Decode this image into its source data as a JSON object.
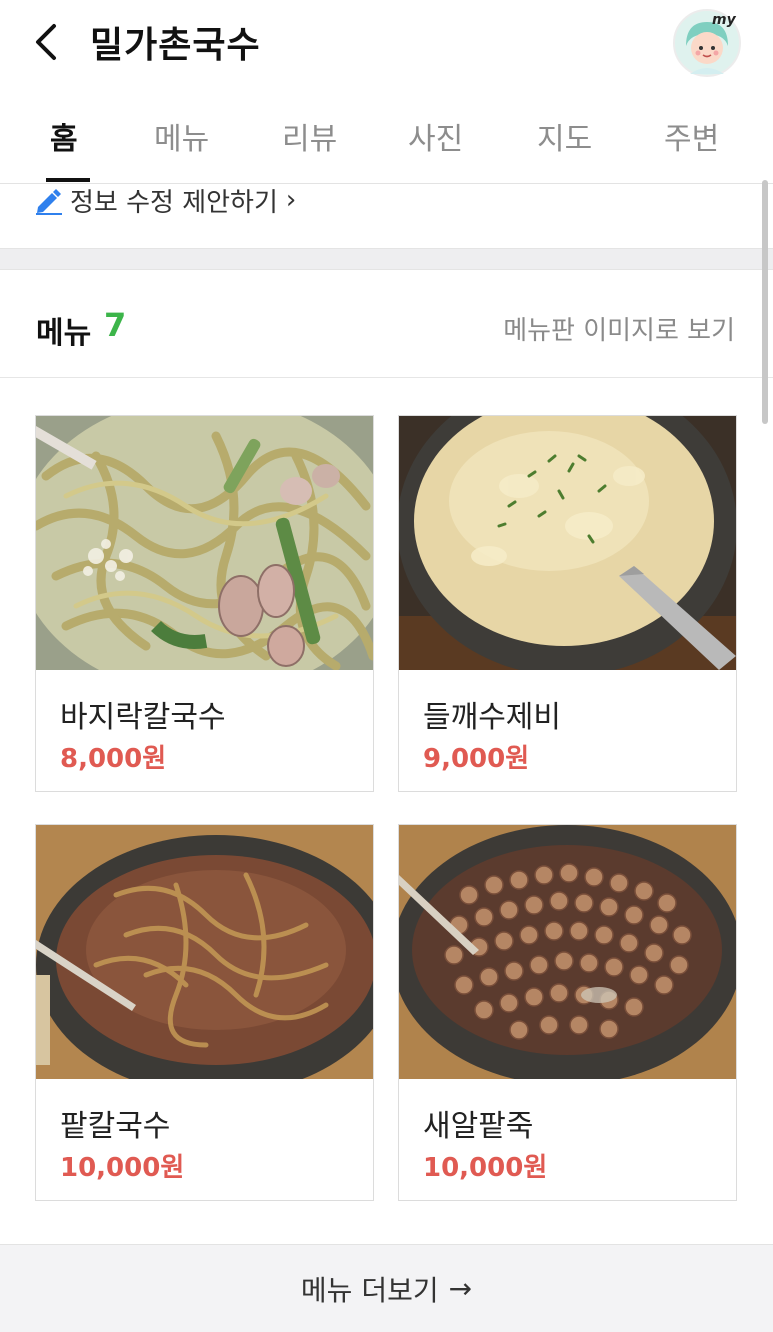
{
  "header": {
    "title": "밀가촌국수",
    "avatar_badge": "my",
    "back_icon": "chevron-left-icon"
  },
  "tabs": [
    {
      "label": "홈",
      "active": true
    },
    {
      "label": "메뉴",
      "active": false
    },
    {
      "label": "리뷰",
      "active": false
    },
    {
      "label": "사진",
      "active": false
    },
    {
      "label": "지도",
      "active": false
    },
    {
      "label": "주변",
      "active": false
    }
  ],
  "edit_suggestion": {
    "label": "정보 수정 제안하기",
    "chevron": "›",
    "icon": "pencil-icon"
  },
  "menu_section": {
    "label": "메뉴",
    "count": "7",
    "board_link": "메뉴판 이미지로 보기",
    "items": [
      {
        "name": "바지락칼국수",
        "price": "8,000원"
      },
      {
        "name": "들깨수제비",
        "price": "9,000원"
      },
      {
        "name": "팥칼국수",
        "price": "10,000원"
      },
      {
        "name": "새알팥죽",
        "price": "10,000원"
      }
    ],
    "more_label": "메뉴 더보기",
    "more_arrow": "→"
  },
  "colors": {
    "accent_green": "#3cb54a",
    "price_red": "#e05a52",
    "pencil_blue": "#2f80ed"
  }
}
